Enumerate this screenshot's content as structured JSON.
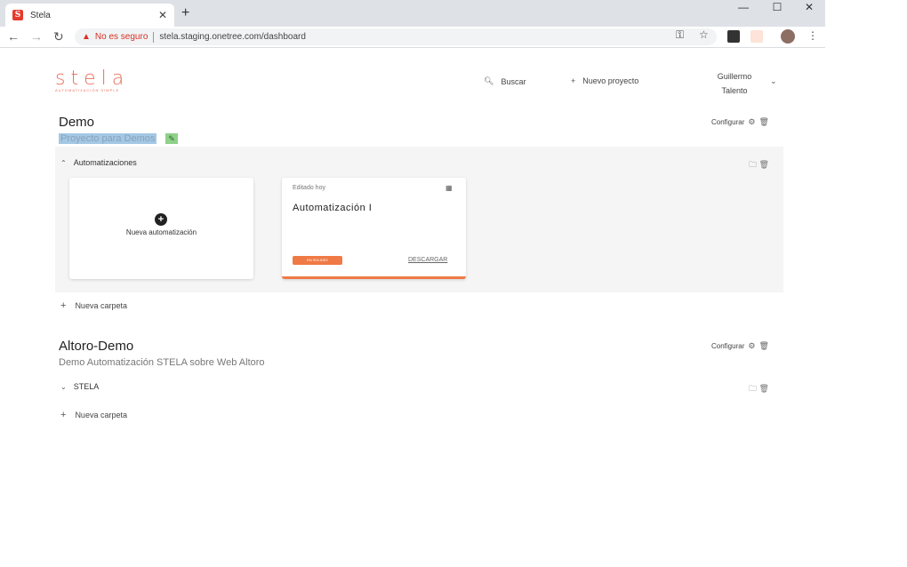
{
  "browser": {
    "tab_title": "Stela",
    "tab_favicon_letter": "S",
    "new_tab": "+",
    "security_label": "No es seguro",
    "url": "stela.staging.onetree.com/dashboard"
  },
  "header": {
    "logo": "stela",
    "logo_tagline": "AUTOMATIZACIÓN SIMPLE",
    "search_label": "Buscar",
    "new_project_label": "Nuevo proyecto",
    "user_first": "Guillermo",
    "user_last": "Talento"
  },
  "projects": [
    {
      "title": "Demo",
      "description": "Proyecto para Demos",
      "configure_label": "Configurar",
      "folder": {
        "name": "Automatizaciones",
        "new_card_label": "Nueva automatización",
        "automation": {
          "edited": "Editado hoy",
          "name": "Automatización I",
          "badge": "EN SOLIDEZ",
          "download": "DESCARGAR"
        }
      },
      "new_folder_label": "Nueva carpeta"
    },
    {
      "title": "Altoro-Demo",
      "description": "Demo Automatización STELA sobre Web Altoro",
      "configure_label": "Configurar",
      "folder": {
        "name": "STELA"
      },
      "new_folder_label": "Nueva carpeta"
    }
  ]
}
